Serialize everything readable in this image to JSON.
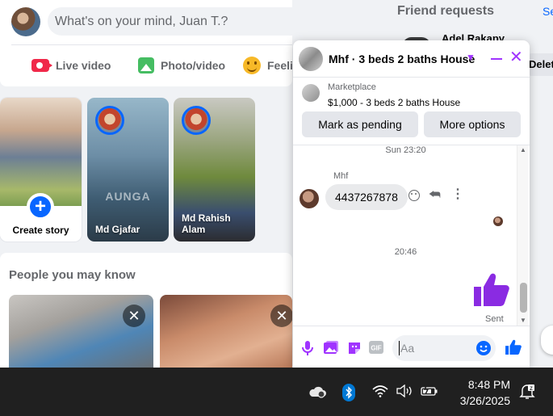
{
  "composer": {
    "placeholder": "What's on your mind, Juan T.?",
    "live_label": "Live video",
    "photo_label": "Photo/video",
    "feeling_label": "Feelin"
  },
  "stories": {
    "create_label": "Create story",
    "items": [
      {
        "name": "Md Gjafar",
        "watermark": "AUNGA"
      },
      {
        "name": "Md Rahish Alam",
        "watermark": ""
      }
    ]
  },
  "pymk": {
    "title": "People you may know",
    "close_glyph": "✕"
  },
  "friend_requests": {
    "title": "Friend requests",
    "see_all": "Se",
    "name": "Adel Rakapy",
    "delete_label": "Delet"
  },
  "chat": {
    "title": "Mhf · 3 beds 2 baths House",
    "marketplace": {
      "category": "Marketplace",
      "item": "$1,000 - 3 beds 2 baths House",
      "mark_pending": "Mark as pending",
      "more_options": "More options"
    },
    "time_1": "Sun 23:20",
    "sender": "Mhf",
    "incoming_message": "4437267878",
    "time_2": "20:46",
    "sent_status": "Sent",
    "input_placeholder": "Aa",
    "accent": "#a033ff"
  },
  "taskbar": {
    "time": "8:48 PM",
    "date": "3/26/2025"
  },
  "colors": {
    "brand_blue": "#0866ff",
    "chat_accent": "#a033ff",
    "taskbar_bg": "#202020"
  }
}
